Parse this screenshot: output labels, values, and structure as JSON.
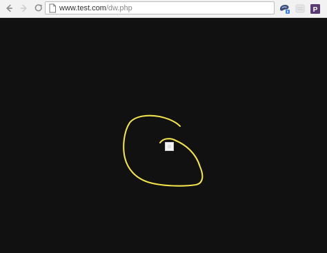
{
  "browser": {
    "back_icon": "arrow-left-icon",
    "forward_icon": "arrow-right-icon",
    "reload_icon": "reload-icon",
    "page_icon": "page-icon",
    "address": {
      "url_domain": "www.test.com",
      "url_path": "/dw.php"
    },
    "extensions": [
      {
        "name": "bird-extension",
        "icon": "bird-icon"
      },
      {
        "name": "ghost-extension",
        "icon": "ghost-icon"
      },
      {
        "name": "pocket-extension",
        "label": "P"
      }
    ]
  },
  "canvas": {
    "background": "#111111",
    "stroke_color": "#f0e24a",
    "cursor": "white-square"
  }
}
